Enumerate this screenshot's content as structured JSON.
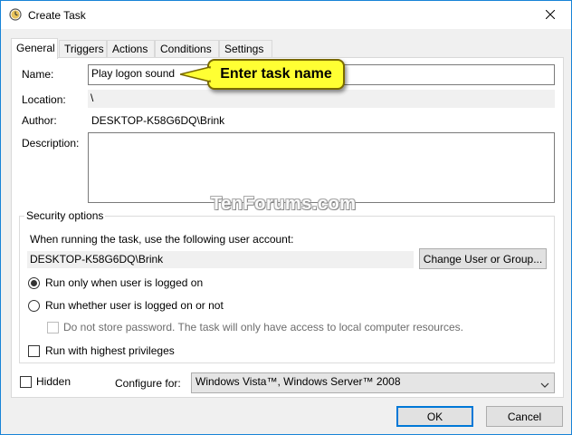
{
  "window": {
    "title": "Create Task"
  },
  "tabs": [
    "General",
    "Triggers",
    "Actions",
    "Conditions",
    "Settings"
  ],
  "general": {
    "name_label": "Name:",
    "name_value": "Play logon sound",
    "location_label": "Location:",
    "location_value": "\\",
    "author_label": "Author:",
    "author_value": "DESKTOP-K58G6DQ\\Brink",
    "description_label": "Description:",
    "description_value": ""
  },
  "security": {
    "legend": "Security options",
    "account_prompt": "When running the task, use the following user account:",
    "account_value": "DESKTOP-K58G6DQ\\Brink",
    "change_button": "Change User or Group...",
    "radio_logged_on": "Run only when user is logged on",
    "radio_whether": "Run whether user is logged on or not",
    "no_store_password": "Do not store password.  The task will only have access to local computer resources.",
    "highest_privileges": "Run with highest privileges"
  },
  "bottom": {
    "hidden_label": "Hidden",
    "configure_label": "Configure for:",
    "configure_value": "Windows Vista™, Windows Server™ 2008",
    "ok_button": "OK",
    "cancel_button": "Cancel"
  },
  "annotation": {
    "callout": "Enter task name",
    "watermark": "TenForums.com"
  },
  "colors": {
    "accent": "#0078d7",
    "callout": "#ffff33",
    "panel": "#ffffff",
    "window": "#f0f0f0"
  }
}
